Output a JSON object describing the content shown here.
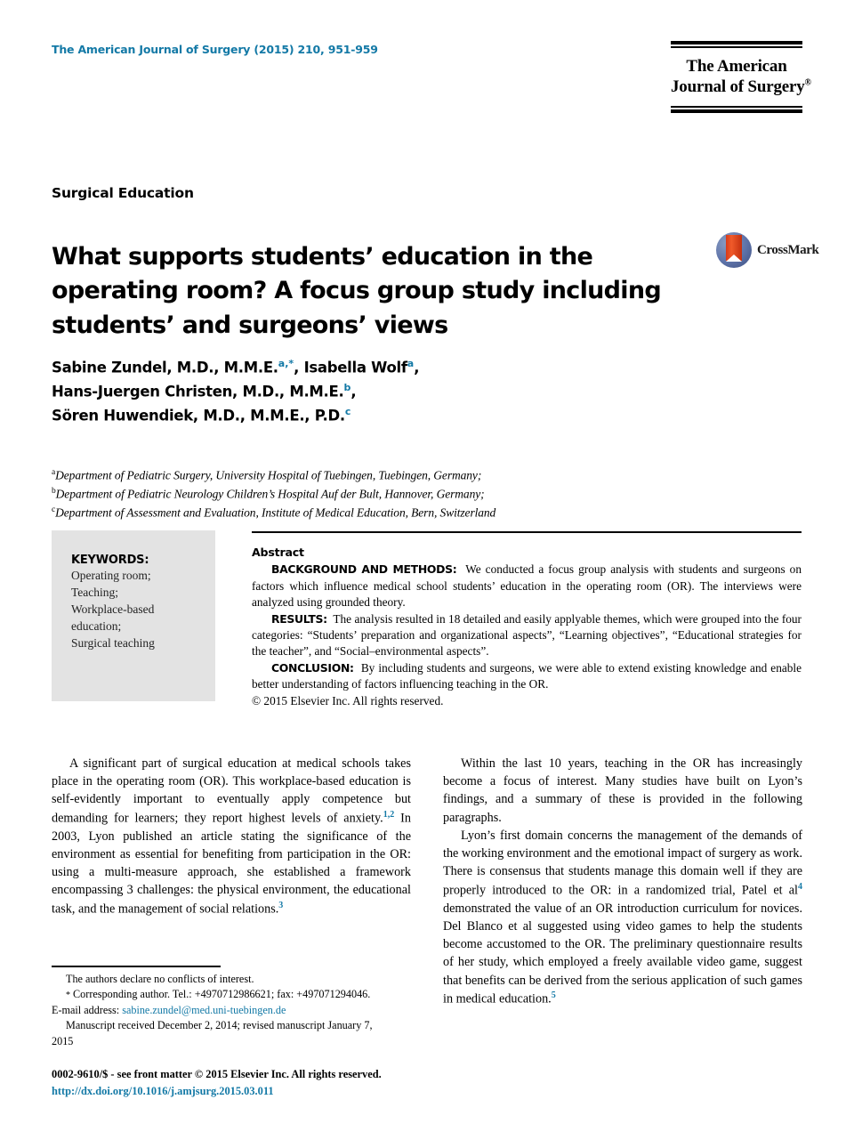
{
  "masthead": {
    "journal_reference": "The American Journal of Surgery (2015) 210, 951-959",
    "logo_line1": "The American",
    "logo_line2": "Journal of Surgery",
    "logo_trademark": "®"
  },
  "crossmark": {
    "label": "CrossMark",
    "icon": "crossmark-logo"
  },
  "article": {
    "section_label": "Surgical Education",
    "title": "What supports students’ education in the operating room? A focus group study including students’ and surgeons’ views"
  },
  "authors": {
    "line1_a": "Sabine Zundel, M.D., M.M.E.",
    "line1_sup1": "a,",
    "line1_star": "*",
    "line1_b": ", Isabella Wolf",
    "line1_sup2": "a",
    "line1_c": ",",
    "line2_a": "Hans-Juergen Christen, M.D., M.M.E.",
    "line2_sup": "b",
    "line2_b": ",",
    "line3_a": "Sören Huwendiek, M.D., M.M.E., P.D.",
    "line3_sup": "c"
  },
  "affiliations": [
    {
      "marker": "a",
      "text": "Department of Pediatric Surgery, University Hospital of Tuebingen, Tuebingen, Germany;"
    },
    {
      "marker": "b",
      "text": "Department of Pediatric Neurology Children’s Hospital Auf der Bult, Hannover, Germany;"
    },
    {
      "marker": "c",
      "text": "Department of Assessment and Evaluation, Institute of Medical Education, Bern, Switzerland"
    }
  ],
  "keywords": {
    "heading": "KEYWORDS:",
    "items": "Operating room;\nTeaching;\nWorkplace-based education;\nSurgical teaching"
  },
  "abstract": {
    "heading": "Abstract",
    "background_label": "BACKGROUND AND METHODS:",
    "background_text": "We conducted a focus group analysis with students and surgeons on factors which influence medical school students’ education in the operating room (OR). The interviews were analyzed using grounded theory.",
    "results_label": "RESULTS:",
    "results_text": "The analysis resulted in 18 detailed and easily applyable themes, which were grouped into the four categories: “Students’ preparation and organizational aspects”, “Learning objectives”, “Educational strategies for the teacher”, and “Social–environmental aspects”.",
    "conclusion_label": "CONCLUSION:",
    "conclusion_text": "By including students and surgeons, we were able to extend existing knowledge and enable better understanding of factors influencing teaching in the OR.",
    "copyright": "© 2015 Elsevier Inc. All rights reserved."
  },
  "body": {
    "left_p1_a": "A significant part of surgical education at medical schools takes place in the operating room (OR). This workplace-based education is self-evidently important to eventually apply competence but demanding for learners; they report highest levels of anxiety.",
    "left_p1_ref1": "1,2",
    "left_p1_b": " In 2003, Lyon published an article stating the significance of the environment as essential for benefiting from participation in the OR: using a multi-measure approach, she established a framework encompassing 3 challenges: the physical environment, the educational task, and the management of social relations.",
    "left_p1_ref2": "3",
    "right_p1": "Within the last 10 years, teaching in the OR has increasingly become a focus of interest. Many studies have built on Lyon’s findings, and a summary of these is provided in the following paragraphs.",
    "right_p2_a": "Lyon’s first domain concerns the management of the demands of the working environment and the emotional impact of surgery as work. There is consensus that students manage this domain well if they are properly introduced to the OR: in a randomized trial, Patel et al",
    "right_p2_ref1": "4",
    "right_p2_b": " demonstrated the value of an OR introduction curriculum for novices. Del Blanco et al suggested using video games to help the students become accustomed to the OR. The preliminary questionnaire results of her study, which employed a freely available video game, suggest that benefits can be derived from the serious application of such games in medical education.",
    "right_p2_ref2": "5"
  },
  "footnotes": {
    "conflicts": "The authors declare no conflicts of interest.",
    "corresponding_star": "*",
    "corresponding": "Corresponding author. Tel.: +4970712986621; fax: +497071294046.",
    "email_label": "E-mail address:",
    "email": "sabine.zundel@med.uni-tuebingen.de",
    "manuscript_line1": "Manuscript received December 2, 2014; revised manuscript January 7,",
    "manuscript_line2": "2015"
  },
  "colophon": {
    "issn_line": "0002-9610/$ - see front matter © 2015 Elsevier Inc. All rights reserved.",
    "doi": "http://dx.doi.org/10.1016/j.amjsurg.2015.03.011"
  },
  "colors": {
    "link_blue": "#1379a6",
    "keywords_bg": "#e3e3e3",
    "crossmark_red": "#d83a1a",
    "crossmark_blue": "#5d72a8"
  }
}
